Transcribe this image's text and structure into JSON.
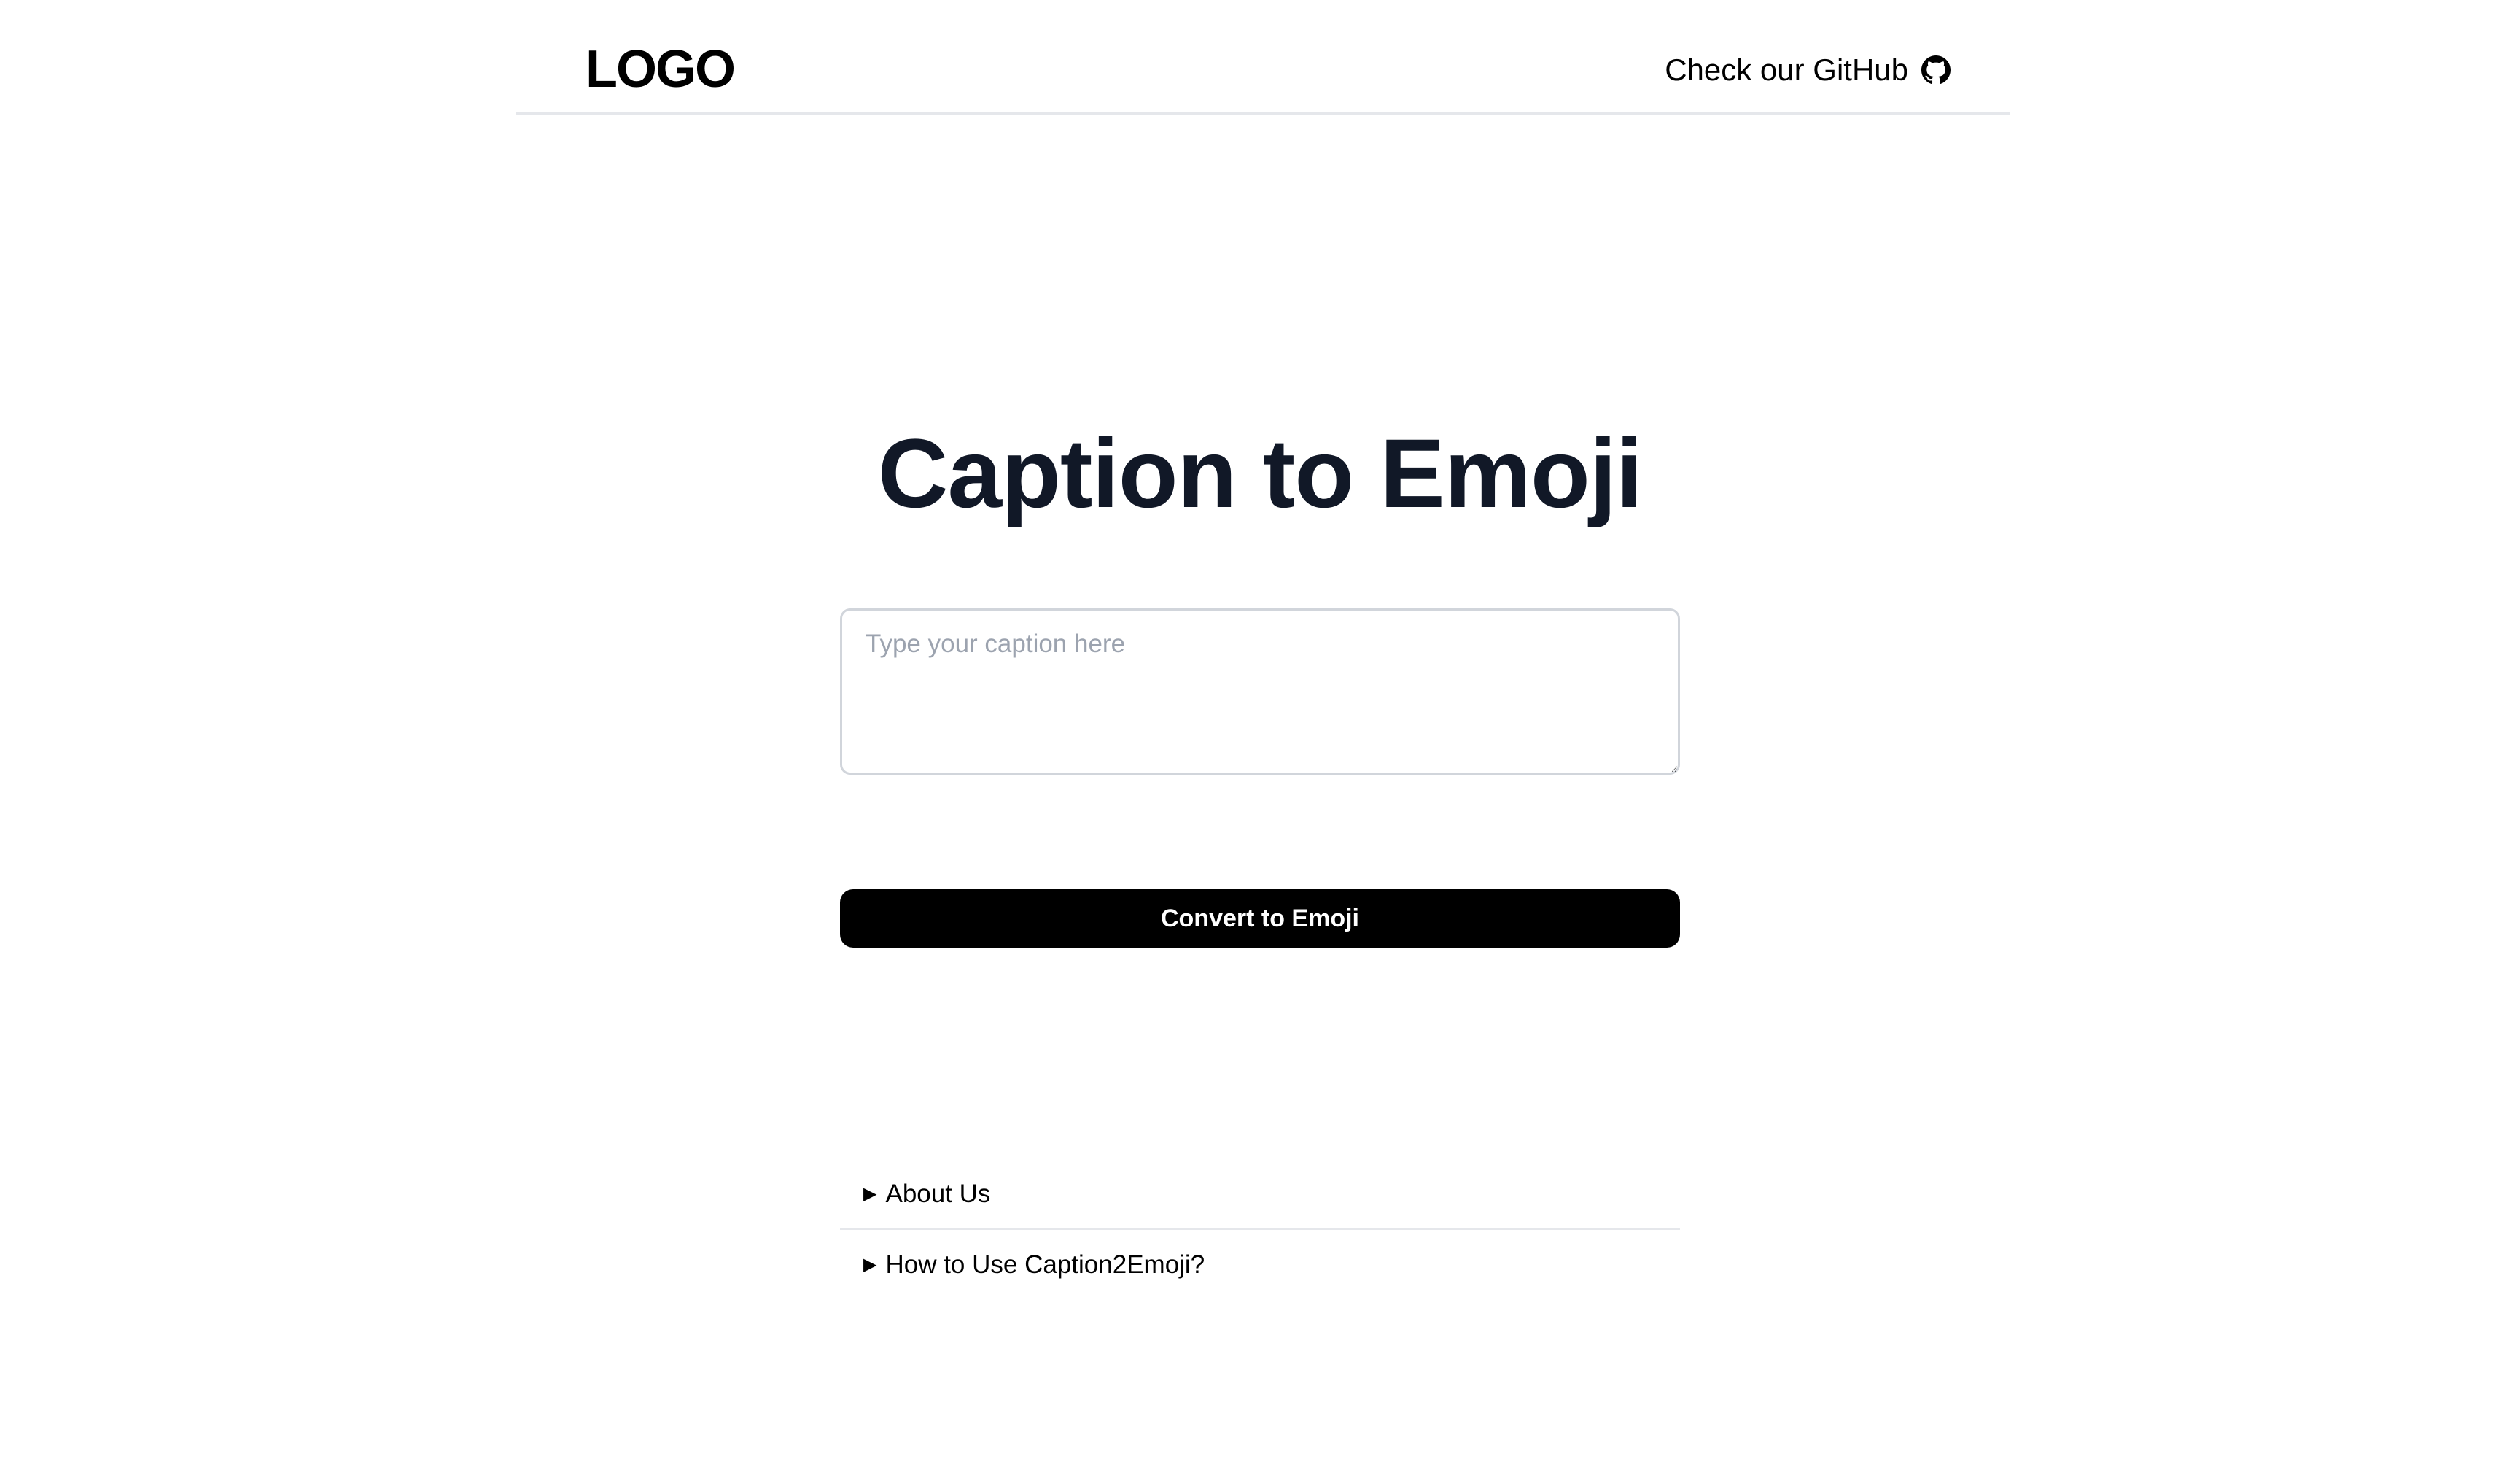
{
  "header": {
    "logo_text": "LOGO",
    "github_link_label": "Check our GitHub",
    "github_icon": "github-icon"
  },
  "main": {
    "title": "Caption to Emoji",
    "caption_input": {
      "placeholder": "Type your caption here",
      "value": ""
    },
    "convert_button_label": "Convert to Emoji"
  },
  "faq": {
    "items": [
      {
        "label": "About Us",
        "expanded": false
      },
      {
        "label": "How to Use Caption2Emoji?",
        "expanded": false
      }
    ],
    "disclosure_icon": "triangle-right-icon"
  },
  "colors": {
    "title": "#111827",
    "button_background": "#000000",
    "button_text": "#ffffff",
    "divider": "#e5e7eb",
    "input_border": "#d1d5db",
    "placeholder": "#9ca3af"
  }
}
